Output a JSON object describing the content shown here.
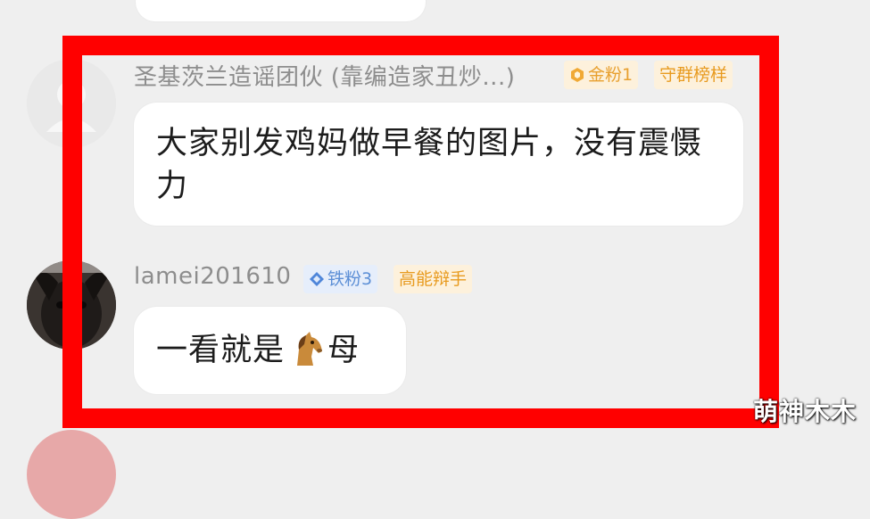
{
  "comments": [
    {
      "username": "圣基茨兰造谣团伙 (靠编造家丑炒...)",
      "fan_badge": "金粉1",
      "role_badge": "守群榜样",
      "message": "大家别发鸡妈做早餐的图片，没有震慑力"
    },
    {
      "username": "lamei201610",
      "fan_badge": "铁粉3",
      "role_badge": "高能辩手",
      "message_before": "一看就是",
      "message_after": "母"
    }
  ],
  "watermark": "萌神木木",
  "colors": {
    "highlight_frame": "#ff0000",
    "gold_badge": "#e8a030",
    "iron_badge": "#5c8fd6",
    "background": "#efefef"
  },
  "icons": {
    "gold": "gold-fan-icon",
    "iron": "iron-fan-icon",
    "emoji": "horse-emoji-icon"
  }
}
